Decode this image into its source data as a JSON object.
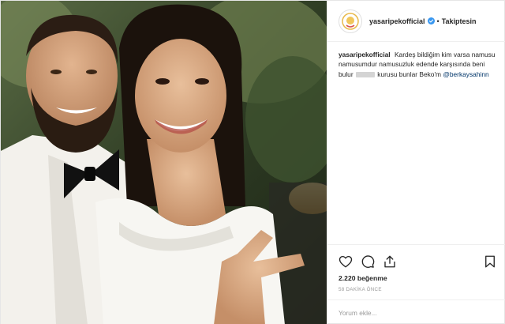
{
  "post": {
    "photo_alt": "",
    "header": {
      "username": "yasaripekofficial",
      "verified": true,
      "separator": "•",
      "follow_label": "Takiptesin"
    },
    "caption": {
      "username": "yasaripekofficial",
      "text_part1": "Kardeş bildiğim kim varsa namusu namusumdur namusuzluk edende karşısında beni bulur",
      "text_part2": "kurusu bunlar Beko'm",
      "mention": "@berkaysahinn"
    },
    "actions": {
      "like_icon": "heart-icon",
      "comment_icon": "comment-icon",
      "share_icon": "share-icon",
      "save_icon": "bookmark-icon"
    },
    "likes": "2.220 beğenme",
    "time_ago": "58 DAKİKA ÖNCE",
    "comment_placeholder": "Yorum ekle..."
  }
}
